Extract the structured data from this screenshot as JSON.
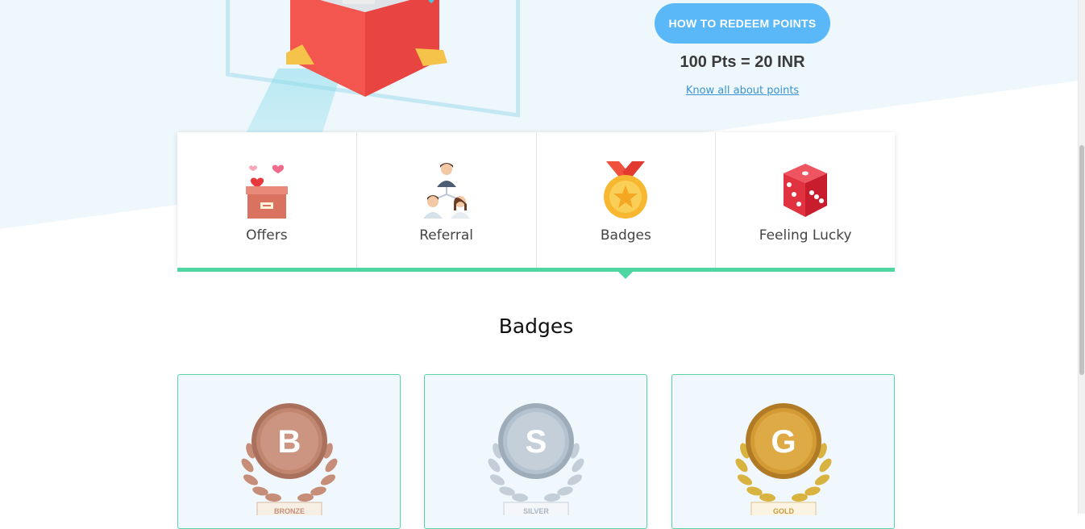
{
  "hero": {
    "redeem_button": "HOW TO REDEEM POINTS",
    "conversion_rate": "100 Pts = 20 INR",
    "know_link": "Know all about points"
  },
  "tabs": [
    {
      "label": "Offers",
      "icon": "offers-box-icon"
    },
    {
      "label": "Referral",
      "icon": "referral-people-icon"
    },
    {
      "label": "Badges",
      "icon": "medal-icon"
    },
    {
      "label": "Feeling Lucky",
      "icon": "dice-icon"
    }
  ],
  "active_tab": "Badges",
  "section": {
    "title": "Badges"
  },
  "badges": [
    {
      "letter": "B",
      "name": "BRONZE",
      "color": "#c0866f"
    },
    {
      "letter": "S",
      "name": "SILVER",
      "color": "#b4c1ce"
    },
    {
      "letter": "G",
      "name": "GOLD",
      "color": "#d49b35"
    }
  ],
  "colors": {
    "accent_green": "#4fd6a3",
    "button_blue": "#5ab8f8",
    "link_blue": "#3a93d6"
  }
}
